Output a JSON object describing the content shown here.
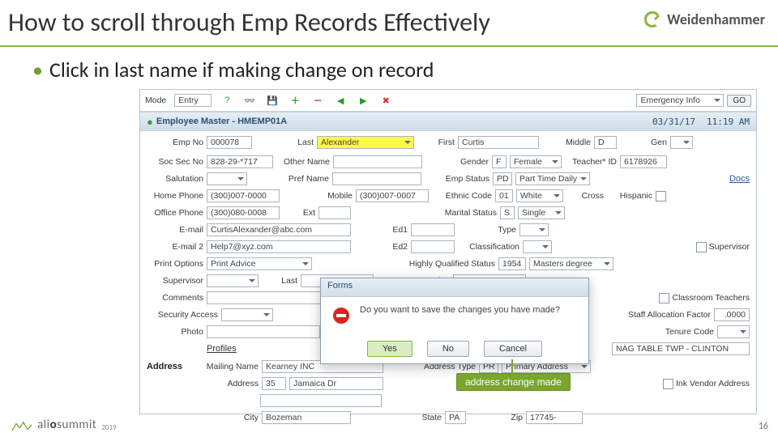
{
  "page": {
    "title": "How to scroll through Emp Records Effectively",
    "bullet": "Click in last name if making change on record",
    "number": "16"
  },
  "brand": {
    "name": "Weidenhammer"
  },
  "logo": {
    "text_a": "ali",
    "text_b": "o",
    "text_c": "summit",
    "year": "2019"
  },
  "toolbar": {
    "mode_label": "Mode",
    "mode_value": "Entry",
    "quick_label": "Emergency Info",
    "go": "GO"
  },
  "subhead": {
    "title": "Employee Master - HMEMP01A",
    "date": "03/31/17",
    "time": "11:19 AM"
  },
  "f": {
    "empno_l": "Emp No",
    "empno_v": "000078",
    "last_l": "Last",
    "last_v": "Alexander",
    "first_l": "First",
    "first_v": "Curtis",
    "middle_l": "Middle",
    "middle_v": "D",
    "gen_l": "Gen",
    "ssn_l": "Soc Sec No",
    "ssn_v": "828-29-*717",
    "other_l": "Other Name",
    "other_v": "",
    "gender_l": "Gender",
    "gender_v": "F",
    "gender_d": "Female",
    "teacher_l": "Teacher* ID",
    "teacher_v": "6178926",
    "sal_l": "Salutation",
    "sal_v": "",
    "pref_l": "Pref Name",
    "pref_v": "",
    "estat_l": "Emp Status",
    "estat_v": "PD",
    "estat_d": "Part Time Daily",
    "docs_link": "Docs",
    "hphone_l": "Home Phone",
    "hphone_v": "(300)007-0000",
    "mobile_l": "Mobile",
    "mobile_v": "(300)007-0007",
    "ethnic_l": "Ethnic Code",
    "ethnic_v": "01",
    "ethnic_d": "White",
    "ophone_l": "Office Phone",
    "ophone_v": "(300)080-0008",
    "ext_l": "Ext",
    "ext_v": "",
    "marital_l": "Marital Status",
    "marital_v": "S",
    "marital_d": "Single",
    "cross_l": "Cross",
    "hispanic_l": "Hispanic",
    "email1_l": "E-mail",
    "email1_v": "CurtisAlexander@abc.com",
    "ed1_l": "Ed1",
    "ed1_v": "",
    "type_l": "Type",
    "type_v": "",
    "email2_l": "E-mail 2",
    "email2_v": "Help7@xyz.com",
    "ed2_l": "Ed2",
    "ed2_v": "",
    "class_l": "Classification",
    "class_v": "",
    "superv_l": "Supervisor",
    "print_l": "Print Options",
    "print_v": "Print Advice",
    "hq_l": "Highly Qualified Status",
    "hq_v": "1954",
    "hq_d": "Masters degree",
    "sup_l": "Supervisor",
    "sup_v": "",
    "sup_last_l": "Last",
    "sup_first_l": "First",
    "comments_l": "Comments",
    "comments_v": "",
    "class_teach": "Classroom Teachers",
    "sec_l": "Security Access",
    "sec_v": "",
    "staff_l": "Staff Allocation Factor",
    "staff_v": ".0000",
    "photo_l": "Photo",
    "tenure_l": "Tenure Code",
    "tenure_v": "",
    "profiles_btn": "Profiles",
    "tenure_loc": "NAG TABLE TWP - CLINTON",
    "addr_section": "Address",
    "mail_l": "Mailing Name",
    "mail_v": "Kearney INC",
    "addrtype_l": "Address Type",
    "addrtype_v": "PR",
    "addrtype_d": "Primary Address",
    "addr_l": "Address",
    "addr_v1": "35",
    "addr_v2": "Jamaica Dr",
    "vendor_chk": "Ink Vendor Address",
    "city_l": "City",
    "city_v": "Bozeman",
    "state_l": "State",
    "state_v": "PA",
    "zip_l": "Zip",
    "zip_v": "17745-"
  },
  "modal": {
    "head": "Forms",
    "body": "Do you want to save the changes you have made?",
    "yes": "Yes",
    "no": "No",
    "cancel": "Cancel"
  },
  "callout": {
    "text": "address change made"
  }
}
